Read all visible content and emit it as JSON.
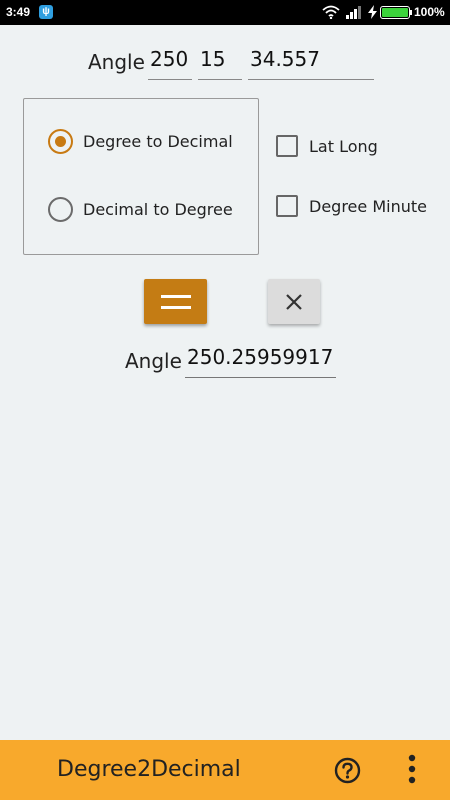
{
  "status_bar": {
    "time": "3:49",
    "battery_percent": "100%",
    "battery_level": 1.0,
    "icons": [
      "usb-icon",
      "wifi-icon",
      "signal-icon",
      "charging-icon",
      "battery-icon"
    ]
  },
  "input": {
    "label": "Angle",
    "degrees": "250",
    "minutes": "15",
    "seconds": "34.557"
  },
  "conversion": {
    "options": [
      {
        "label": "Degree to Decimal",
        "selected": true
      },
      {
        "label": "Decimal to Degree",
        "selected": false
      }
    ]
  },
  "options": {
    "lat_long": {
      "label": "Lat Long",
      "checked": false
    },
    "degree_minute": {
      "label": "Degree Minute",
      "checked": false
    }
  },
  "buttons": {
    "calculate_icon": "equals-icon",
    "clear_icon": "close-icon"
  },
  "output": {
    "label": "Angle",
    "value": "250.25959917"
  },
  "app_bar": {
    "title": "Degree2Decimal",
    "icons": [
      "help-icon",
      "overflow-menu-icon"
    ]
  },
  "colors": {
    "accent": "#c47c14",
    "app_bar": "#f8a92c",
    "background": "#eef2f3"
  }
}
